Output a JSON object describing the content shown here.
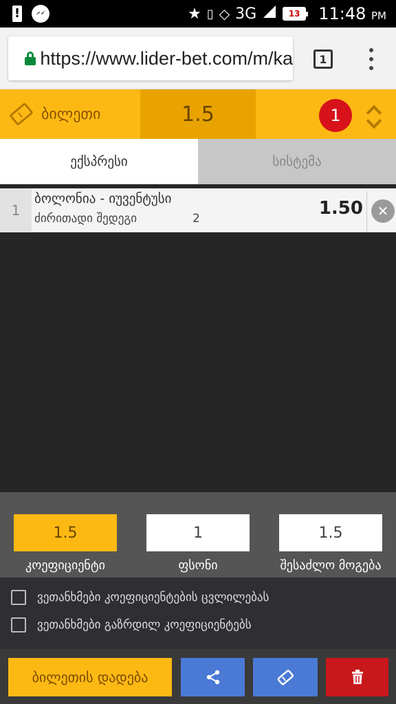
{
  "status_bar": {
    "time": "11:48",
    "ampm": "PM",
    "network": "3G",
    "battery": "13"
  },
  "browser": {
    "url": "https://www.lider-bet.com/m/ka",
    "tab_count": "1"
  },
  "ticket": {
    "label": "ბილეთი",
    "total_odds": "1.5",
    "bet_count": "1"
  },
  "tabs": [
    {
      "label": "ექსპრესი",
      "active": true
    },
    {
      "label": "სისტემა",
      "active": false
    }
  ],
  "bets": [
    {
      "index": "1",
      "match": "ბოლონია - იუვენტუსი",
      "market": "ძირითადი შედეგი",
      "outcome": "2",
      "odds": "1.50"
    }
  ],
  "summary": {
    "coefficient": {
      "value": "1.5",
      "label": "კოეფიციენტი"
    },
    "stake": {
      "value": "1",
      "label": "ფსონი"
    },
    "possible_win": {
      "value": "1.5",
      "label": "შესაძლო მოგება"
    }
  },
  "checkboxes": [
    {
      "label": "ვეთანხმები კოეფიციენტების ცვლილებას",
      "checked": false
    },
    {
      "label": "ვეთანხმები გაზრდილ კოეფიციენტებს",
      "checked": false
    }
  ],
  "actions": {
    "place_bet": "ბილეთის დადება"
  },
  "colors": {
    "accent": "#fdb913",
    "share": "#4b79d6",
    "delete": "#c8181c",
    "badge": "#d7121a"
  }
}
